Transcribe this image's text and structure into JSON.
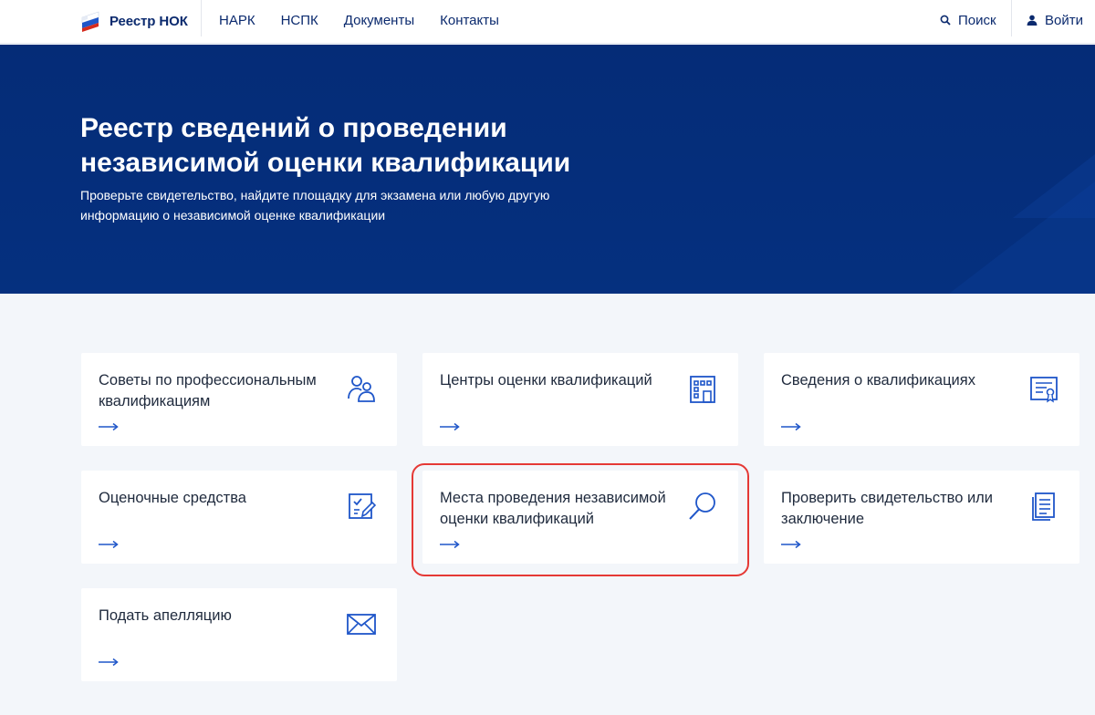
{
  "header": {
    "logo_text": "Реестр НОК",
    "nav": [
      {
        "label": "НАРК"
      },
      {
        "label": "НСПК"
      },
      {
        "label": "Документы"
      },
      {
        "label": "Контакты"
      }
    ],
    "search_label": "Поиск",
    "login_label": "Войти"
  },
  "hero": {
    "title": "Реестр сведений о проведении независимой оценки квалификации",
    "subtitle": "Проверьте свидетельство, найдите площадку для экзамена или любую другую информацию о независимой оценке квалификации"
  },
  "cards": [
    {
      "label": "Советы по профессиональным квалификациям",
      "icon": "people-icon"
    },
    {
      "label": "Центры оценки квалификаций",
      "icon": "building-icon"
    },
    {
      "label": "Сведения о квалификациях",
      "icon": "certificate-icon"
    },
    {
      "label": "Оценочные средства",
      "icon": "checklist-edit-icon"
    },
    {
      "label": "Места проведения независимой оценки квалификаций",
      "icon": "magnifier-icon"
    },
    {
      "label": "Проверить свидетельство или заключение",
      "icon": "documents-icon"
    },
    {
      "label": "Подать апелляцию",
      "icon": "envelope-icon"
    }
  ],
  "colors": {
    "brand_blue": "#0b2a6e",
    "hero_bg": "#052c77",
    "accent_blue": "#1f56c9",
    "highlight": "#e53935"
  }
}
